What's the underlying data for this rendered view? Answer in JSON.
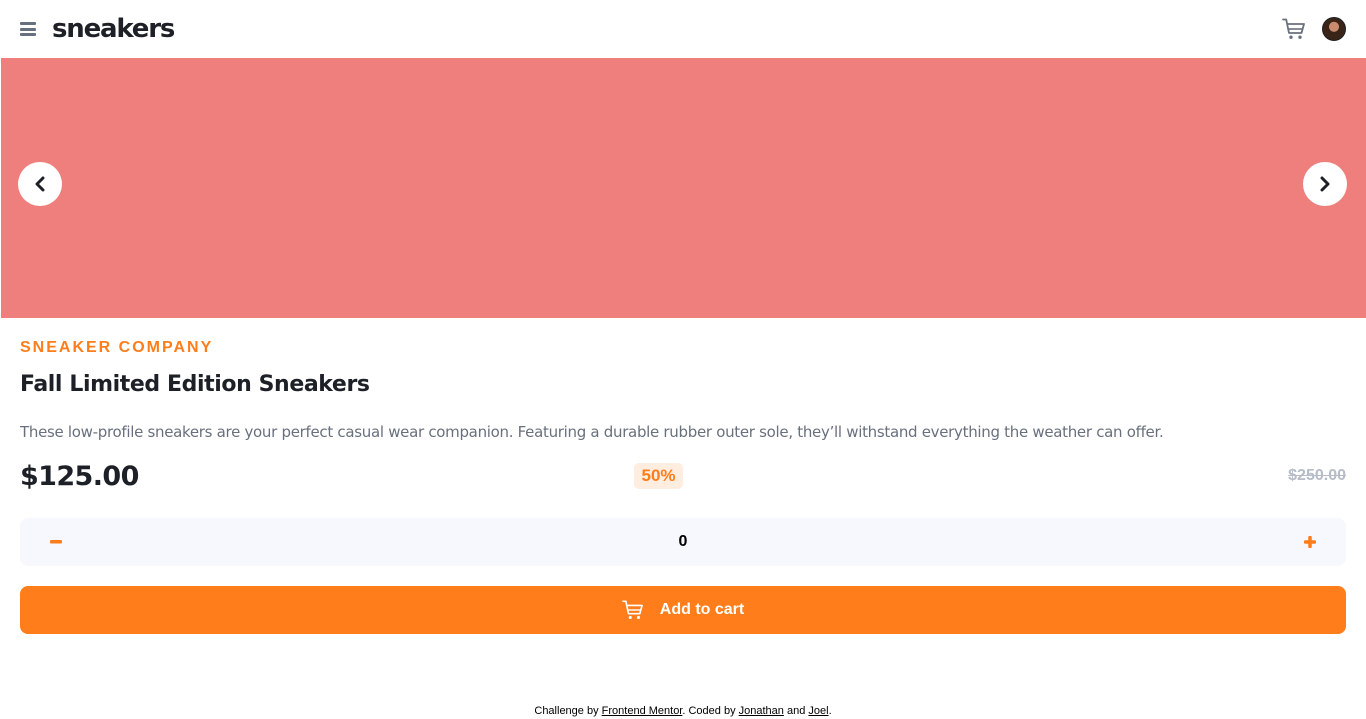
{
  "header": {
    "logo": "sneakers",
    "menu_icon": "hamburger-menu-icon",
    "cart_icon": "cart-icon",
    "avatar": "user-avatar"
  },
  "gallery": {
    "background_color": "#ef7f7c",
    "prev_icon": "chevron-left-icon",
    "next_icon": "chevron-right-icon"
  },
  "product": {
    "company": "SNEAKER COMPANY",
    "title": "Fall Limited Edition Sneakers",
    "description": "These low-profile sneakers are your perfect casual wear companion. Featuring a durable rubber outer sole, they’ll withstand everything the weather can offer.",
    "price": "$125.00",
    "discount": "50%",
    "original_price": "$250.00"
  },
  "quantity": {
    "minus_icon": "minus-icon",
    "value": "0",
    "plus_icon": "plus-icon"
  },
  "cart_button": {
    "label": "Add to cart",
    "icon": "cart-icon"
  },
  "attribution": {
    "prefix": "Challenge by ",
    "challenge_link": "Frontend Mentor",
    "middle": ". Coded by ",
    "author1": "Jonathan",
    "and": " and ",
    "author2": "Joel",
    "suffix": "."
  },
  "colors": {
    "accent": "#ff7e1b",
    "accent_pale": "#ffede0",
    "dark": "#1d2026",
    "gray": "#69707d",
    "light_gray": "#b6bcc8",
    "qty_bg": "#f6f8fd"
  }
}
